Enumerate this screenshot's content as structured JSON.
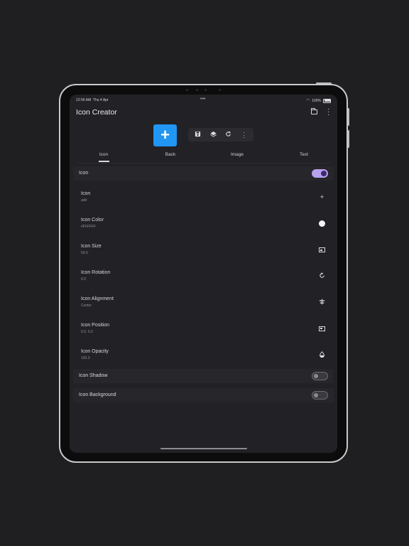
{
  "status_bar": {
    "time": "12:56 AM",
    "date": "Thu 4 Apr",
    "battery": "100%"
  },
  "app": {
    "title": "Icon Creator"
  },
  "toolbar": {
    "add_label": "+"
  },
  "tabs": [
    {
      "label": "Icon",
      "active": true
    },
    {
      "label": "Back",
      "active": false
    },
    {
      "label": "Image",
      "active": false
    },
    {
      "label": "Text",
      "active": false
    }
  ],
  "sections": {
    "icon": {
      "label": "Icon",
      "enabled": true
    },
    "icon_shadow": {
      "label": "Icon Shadow",
      "enabled": false
    },
    "icon_background": {
      "label": "Icon Background",
      "enabled": false
    }
  },
  "items": [
    {
      "label": "Icon",
      "value": "add",
      "icon": "plus-icon"
    },
    {
      "label": "Icon Color",
      "value": "#FFFFFF",
      "icon": "color-dot-icon"
    },
    {
      "label": "Icon Size",
      "value": "50.0",
      "icon": "size-icon"
    },
    {
      "label": "Icon Rotation",
      "value": "0.0",
      "icon": "rotate-icon"
    },
    {
      "label": "Icon Alignment",
      "value": "Center",
      "icon": "align-center-icon"
    },
    {
      "label": "Icon Position",
      "value": "0.0, 0.0",
      "icon": "position-icon"
    },
    {
      "label": "Icon Opacity",
      "value": "100.0",
      "icon": "opacity-drop-icon"
    }
  ],
  "colors": {
    "accent": "#2196f3",
    "toggle_on": "#b8a2f0",
    "background": "#212126"
  }
}
